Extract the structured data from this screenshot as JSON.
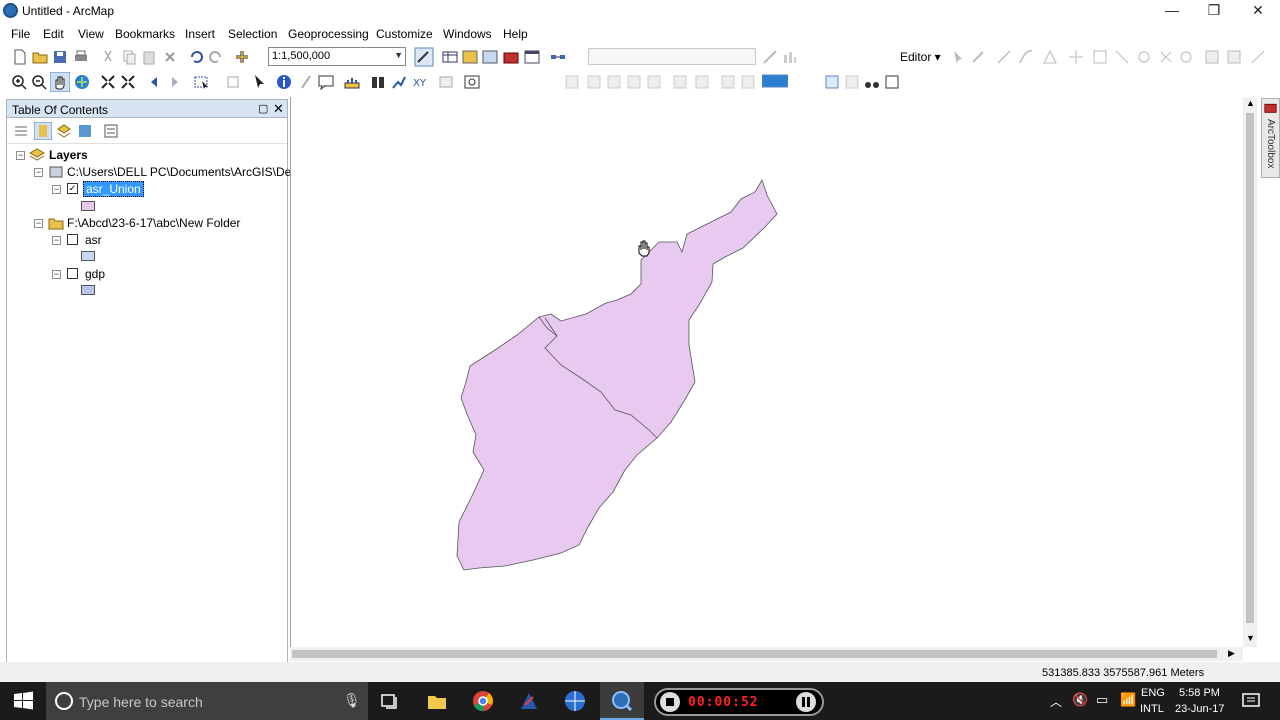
{
  "window": {
    "title": "Untitled - ArcMap",
    "minimize": "—",
    "restore": "❐",
    "close": "✕"
  },
  "menu": [
    "File",
    "Edit",
    "View",
    "Bookmarks",
    "Insert",
    "Selection",
    "Geoprocessing",
    "Customize",
    "Windows",
    "Help"
  ],
  "toolbar": {
    "scale_value": "1:1,500,000",
    "editor_label": "Editor ▾"
  },
  "toc": {
    "title": "Table Of Contents",
    "root_label": "Layers",
    "group1_label": "C:\\Users\\DELL PC\\Documents\\ArcGIS\\Defau",
    "layer1_label": "asr_Union",
    "layer1_checked": "✓",
    "group2_label": "F:\\Abcd\\23-6-17\\abc\\New Folder",
    "layer2_label": "asr",
    "layer3_label": "gdp",
    "layer1_color": "#e6c8ee",
    "layer2_color": "#c6d8f0",
    "layer3_color": "#b8c4ec"
  },
  "map": {
    "polygon_fill": "#e8c9f0",
    "polygon_stroke": "#555555"
  },
  "arctoolbox_label": "ArcToolbox",
  "status": {
    "coordinates": "531385.833  3575587.961 Meters"
  },
  "taskbar": {
    "search_placeholder": "Type here to search",
    "recorder_time": "00:00:52",
    "lang_top": "ENG",
    "lang_bottom": "INTL",
    "time": "5:58 PM",
    "date": "23-Jun-17"
  }
}
